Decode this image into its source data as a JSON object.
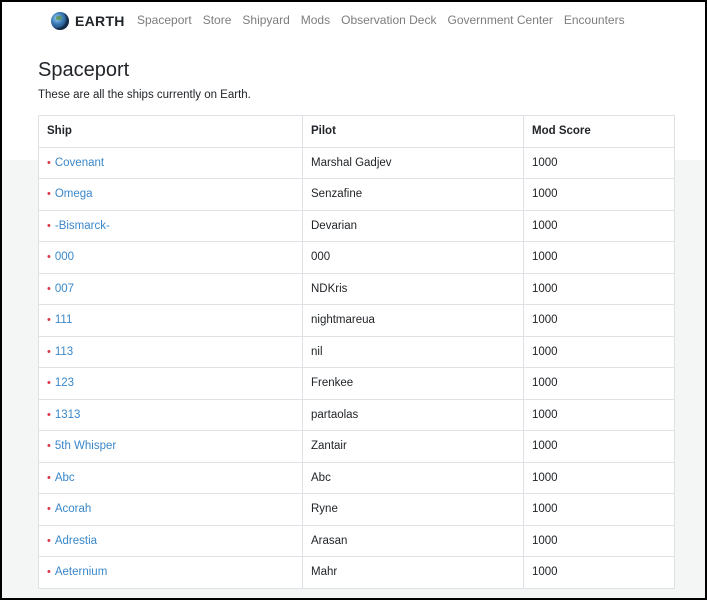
{
  "brand": {
    "name": "EARTH",
    "icon": "earth-globe-icon"
  },
  "nav": {
    "links": [
      "Spaceport",
      "Store",
      "Shipyard",
      "Mods",
      "Observation Deck",
      "Government Center",
      "Encounters"
    ]
  },
  "page": {
    "title": "Spaceport",
    "subtitle": "These are all the ships currently on Earth."
  },
  "table": {
    "headers": {
      "ship": "Ship",
      "pilot": "Pilot",
      "mod_score": "Mod Score"
    },
    "bullet": "•",
    "rows": [
      {
        "ship": "Covenant",
        "pilot": "Marshal Gadjev",
        "mod_score": "1000"
      },
      {
        "ship": "Omega",
        "pilot": "Senzafine",
        "mod_score": "1000"
      },
      {
        "ship": "-Bismarck-",
        "pilot": "Devarian",
        "mod_score": "1000"
      },
      {
        "ship": "000",
        "pilot": "000",
        "mod_score": "1000"
      },
      {
        "ship": "007",
        "pilot": "NDKris",
        "mod_score": "1000"
      },
      {
        "ship": "111",
        "pilot": "nightmareua",
        "mod_score": "1000"
      },
      {
        "ship": "113",
        "pilot": "nil",
        "mod_score": "1000"
      },
      {
        "ship": "123",
        "pilot": "Frenkee",
        "mod_score": "1000"
      },
      {
        "ship": "1313",
        "pilot": "partaolas",
        "mod_score": "1000"
      },
      {
        "ship": "5th Whisper",
        "pilot": "Zantair",
        "mod_score": "1000"
      },
      {
        "ship": "Abc",
        "pilot": "Abc",
        "mod_score": "1000"
      },
      {
        "ship": "Acorah",
        "pilot": "Ryne",
        "mod_score": "1000"
      },
      {
        "ship": "Adrestia",
        "pilot": "Arasan",
        "mod_score": "1000"
      },
      {
        "ship": "Aeternium",
        "pilot": "Mahr",
        "mod_score": "1000"
      }
    ]
  },
  "colors": {
    "link": "#3a87c9",
    "bullet": "#dc3545",
    "nav_link": "#7d7d7d",
    "text": "#212529",
    "border": "#dee2e6"
  }
}
